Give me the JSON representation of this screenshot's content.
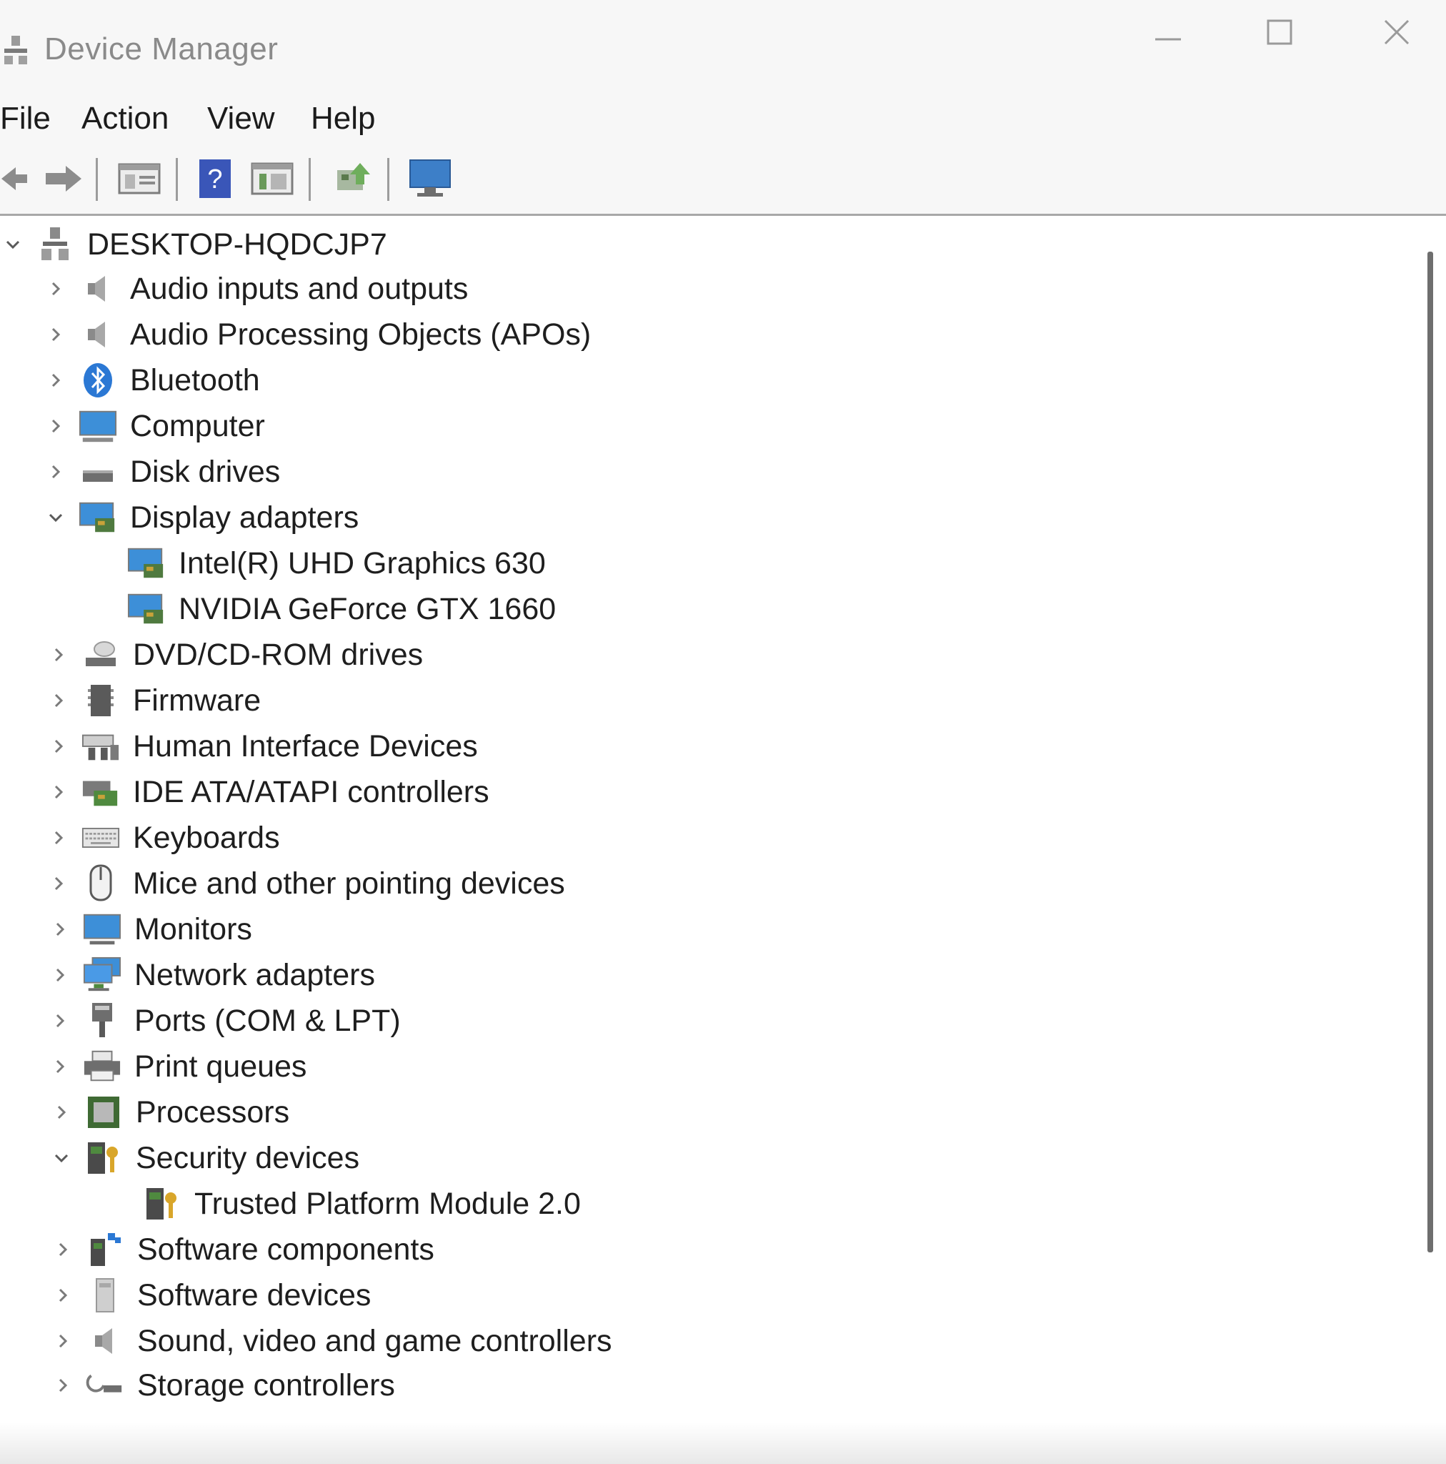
{
  "window": {
    "title": "Device Manager"
  },
  "menu": {
    "file": "File",
    "action": "Action",
    "view": "View",
    "help": "Help"
  },
  "toolbar": {
    "icons": [
      "back-icon",
      "forward-icon",
      "properties-icon",
      "help-icon",
      "show-hide-console-tree-icon",
      "update-driver-icon",
      "monitor-icon"
    ]
  },
  "tree": {
    "root": "DESKTOP-HQDCJP7",
    "categories": [
      {
        "label": "Audio inputs and outputs",
        "icon": "speaker-icon",
        "expanded": false
      },
      {
        "label": "Audio Processing Objects (APOs)",
        "icon": "speaker-icon",
        "expanded": false
      },
      {
        "label": "Bluetooth",
        "icon": "bluetooth-icon",
        "expanded": false
      },
      {
        "label": "Computer",
        "icon": "computer-icon",
        "expanded": false
      },
      {
        "label": "Disk drives",
        "icon": "disk-drive-icon",
        "expanded": false
      },
      {
        "label": "Display adapters",
        "icon": "display-adapter-icon",
        "expanded": true,
        "children": [
          "Intel(R) UHD Graphics 630",
          "NVIDIA GeForce GTX 1660"
        ]
      },
      {
        "label": "DVD/CD-ROM drives",
        "icon": "optical-drive-icon",
        "expanded": false
      },
      {
        "label": "Firmware",
        "icon": "firmware-icon",
        "expanded": false
      },
      {
        "label": "Human Interface Devices",
        "icon": "hid-icon",
        "expanded": false
      },
      {
        "label": "IDE ATA/ATAPI controllers",
        "icon": "ide-controller-icon",
        "expanded": false
      },
      {
        "label": "Keyboards",
        "icon": "keyboard-icon",
        "expanded": false
      },
      {
        "label": "Mice and other pointing devices",
        "icon": "mouse-icon",
        "expanded": false
      },
      {
        "label": "Monitors",
        "icon": "monitor-icon",
        "expanded": false
      },
      {
        "label": "Network adapters",
        "icon": "network-adapter-icon",
        "expanded": false
      },
      {
        "label": "Ports (COM & LPT)",
        "icon": "port-icon",
        "expanded": false
      },
      {
        "label": "Print queues",
        "icon": "printer-icon",
        "expanded": false
      },
      {
        "label": "Processors",
        "icon": "processor-icon",
        "expanded": false
      },
      {
        "label": "Security devices",
        "icon": "security-device-icon",
        "expanded": true,
        "children": [
          "Trusted Platform Module 2.0"
        ]
      },
      {
        "label": "Software components",
        "icon": "software-component-icon",
        "expanded": false
      },
      {
        "label": "Software devices",
        "icon": "software-device-icon",
        "expanded": false
      },
      {
        "label": "Sound, video and game controllers",
        "icon": "speaker-icon",
        "expanded": false
      },
      {
        "label": "Storage controllers",
        "icon": "storage-controller-icon",
        "expanded": false
      }
    ]
  },
  "colors": {
    "accent_blue": "#2b78d4",
    "chrome_bg": "#f7f7f7",
    "text": "#1e1e1e"
  }
}
